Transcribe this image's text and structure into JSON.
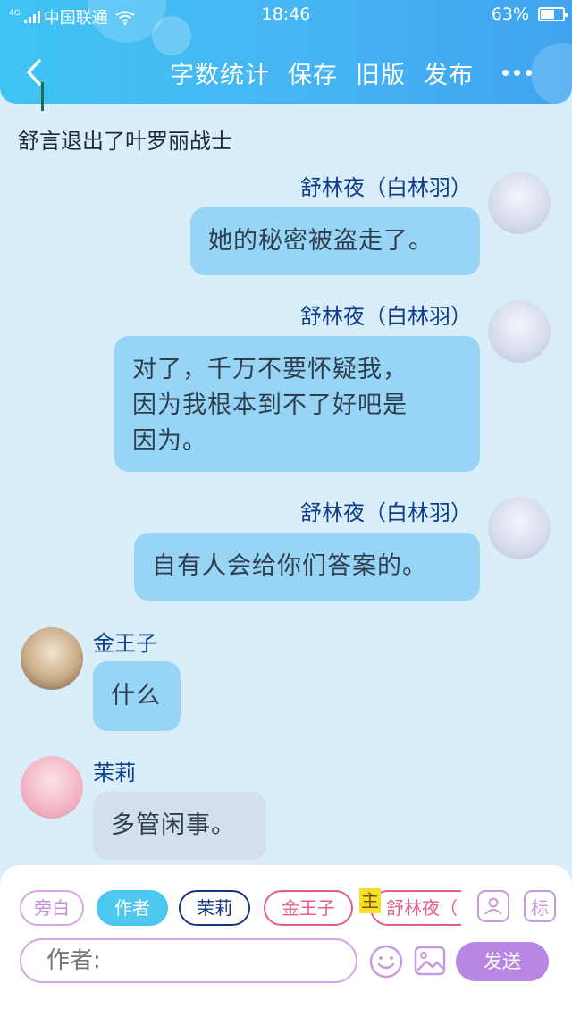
{
  "status_bar": {
    "network": "4G",
    "carrier": "中国联通",
    "time": "18:46",
    "battery_percent": "63%",
    "battery_level": 0.63
  },
  "navbar": {
    "back_icon": "chevron-left-icon",
    "items": [
      "字数统计",
      "保存",
      "旧版",
      "发布"
    ],
    "more_icon": "more-dots-icon"
  },
  "system_message": "舒言退出了叶罗丽战士",
  "messages": [
    {
      "name": "舒林夜（白林羽）",
      "lines": [
        "她的秘密被盗走了。"
      ],
      "side": "right"
    },
    {
      "name": "舒林夜（白林羽）",
      "lines": [
        "对了，千万不要怀疑我，",
        "因为我根本到不了好吧是",
        "因为。"
      ],
      "side": "right"
    },
    {
      "name": "舒林夜（白林羽）",
      "lines": [
        "自有人会给你们答案的。"
      ],
      "side": "right"
    },
    {
      "name": "金王子",
      "lines": [
        "什么"
      ],
      "side": "left"
    },
    {
      "name": "茉莉",
      "lines": [
        "多管闲事。"
      ],
      "side": "left"
    }
  ],
  "roles": {
    "pangbai": "旁白",
    "zuozhe": "作者",
    "moli": "茉莉",
    "jin": "金王子",
    "zhu_badge": "主",
    "shu": "舒林夜（"
  },
  "panel_icons": {
    "person": "person-card-icon",
    "biao": "标"
  },
  "input": {
    "placeholder": "作者:",
    "value": ""
  },
  "send_label": "发送",
  "colors": {
    "header": "#47b6f3",
    "bubble_blue": "#97d4f6",
    "send": "#b886e4"
  }
}
